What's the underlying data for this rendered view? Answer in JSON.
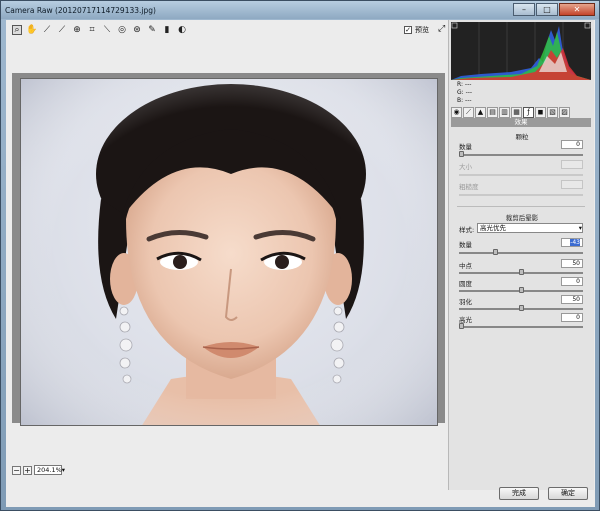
{
  "window": {
    "title": "Camera Raw (20120717114729133.jpg)",
    "controls": {
      "minimize": "–",
      "maximize": "□",
      "close": "✕"
    }
  },
  "toolbar": {
    "tools": [
      "zoom-icon",
      "hand-icon",
      "white-balance-icon",
      "color-sampler-icon",
      "target-adjust-icon",
      "crop-icon",
      "straighten-icon",
      "spot-removal-icon",
      "redeye-icon",
      "adjustment-brush-icon",
      "graduated-filter-icon"
    ],
    "preview_label": "预览",
    "preview_checked": true
  },
  "readout": {
    "r": "R:  ---",
    "g": "G:  ---",
    "b": "B:  ---"
  },
  "panel": {
    "header": "效果",
    "grain": {
      "title": "颗粒",
      "amount_label": "数量",
      "amount_value": "0",
      "size_label": "大小",
      "roughness_label": "粗糙度"
    },
    "vignette": {
      "title": "裁剪后晕影",
      "style_label": "样式:",
      "style_value": "高光优先",
      "amount_label": "数量",
      "amount_value": "-43",
      "midpoint_label": "中点",
      "midpoint_value": "50",
      "roundness_label": "圆度",
      "roundness_value": "0",
      "feather_label": "羽化",
      "feather_value": "50",
      "highlights_label": "高光",
      "highlights_value": "0"
    }
  },
  "sliders": {
    "grain_amount": 0.0,
    "vignette_amount": 0.285,
    "midpoint": 0.5,
    "roundness": 0.5,
    "feather": 0.5,
    "highlights": 0.0
  },
  "statusbar": {
    "zoom": "204.1%"
  },
  "buttons": {
    "done": "完成",
    "ok": "确定"
  }
}
